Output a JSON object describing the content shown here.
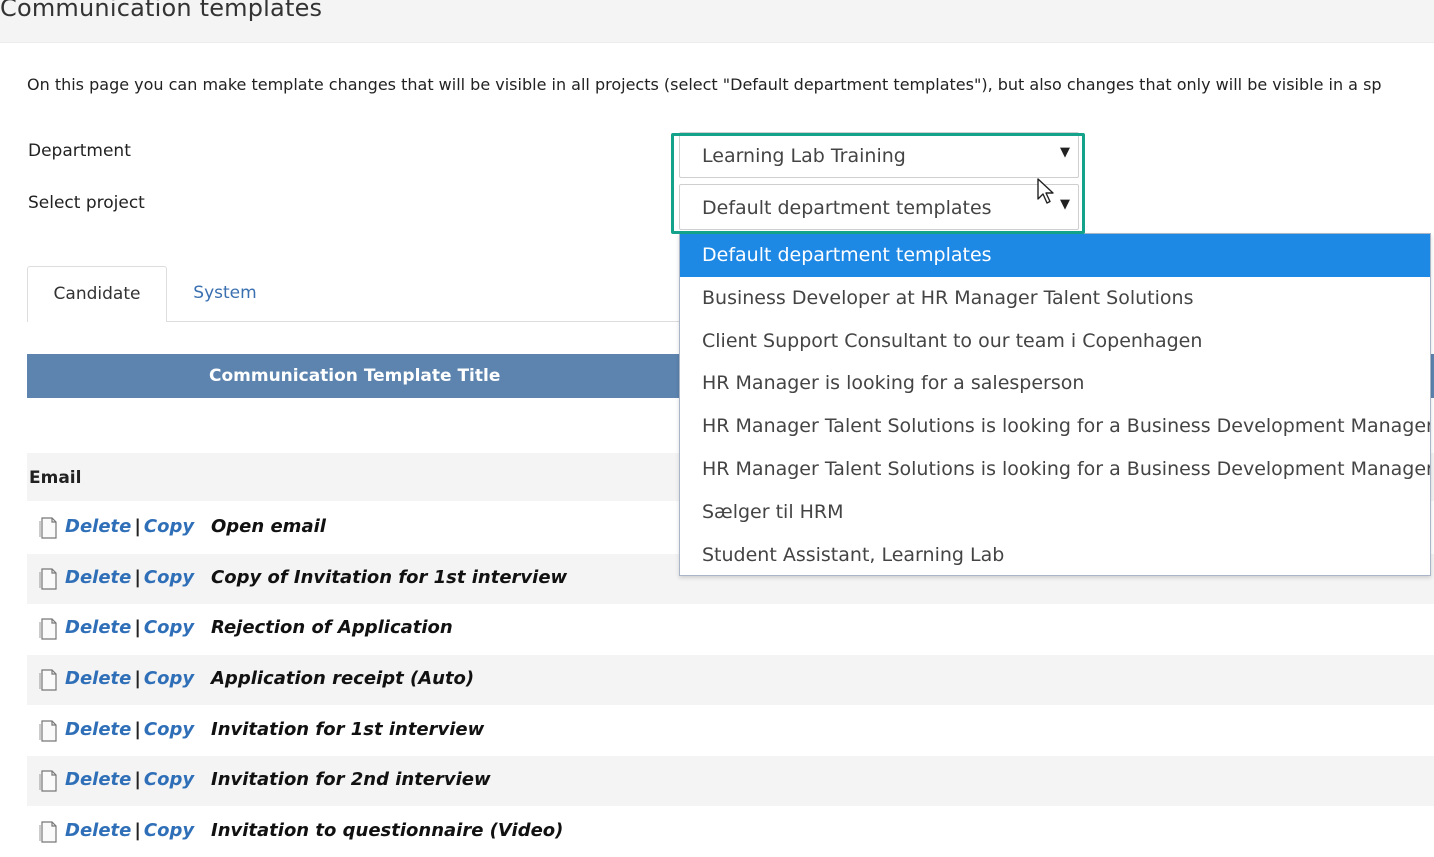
{
  "page": {
    "title": "Communication templates",
    "intro": "On this page you can make template changes that will be visible in all projects (select \"Default department templates\"), but also changes that only will be visible in a sp"
  },
  "form": {
    "department_label": "Department",
    "department_value": "Learning Lab Training",
    "project_label": "Select project",
    "project_value": "Default department templates"
  },
  "tabs": [
    {
      "label": "Candidate",
      "active": true
    },
    {
      "label": "System",
      "active": false
    }
  ],
  "table": {
    "header": "Communication Template Title",
    "section": "Email",
    "delete_label": "Delete",
    "copy_label": "Copy",
    "separator": "|",
    "rows": [
      "Open email",
      "Copy of Invitation for 1st interview",
      "Rejection of Application",
      "Application receipt (Auto)",
      "Invitation for 1st interview",
      "Invitation for 2nd interview",
      "Invitation to questionnaire (Video)"
    ]
  },
  "dropdown": {
    "options": [
      "Default department templates",
      "Business Developer at HR Manager Talent Solutions",
      "Client Support Consultant to our team i Copenhagen",
      "HR Manager is looking for a salesperson",
      "HR Manager Talent Solutions is looking for a Business Development Manager",
      "HR Manager Talent Solutions is looking for a Business Development Manager",
      "Sælger til HRM",
      "Student Assistant, Learning Lab"
    ],
    "selected_index": 0
  },
  "colors": {
    "header_bg": "#5d84af",
    "link": "#2f6fb8",
    "selected_option": "#1e88e5",
    "highlight": "#14a28a"
  }
}
